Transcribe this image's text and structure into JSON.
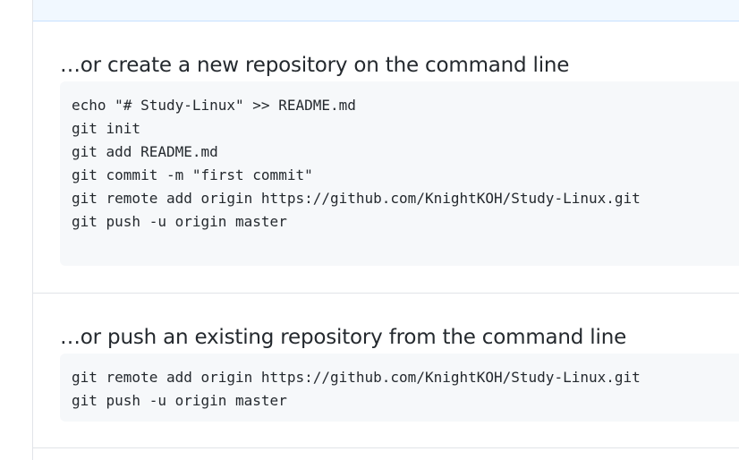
{
  "create_section": {
    "heading": "…or create a new repository on the command line",
    "commands": [
      "echo \"# Study-Linux\" >> README.md",
      "git init",
      "git add README.md",
      "git commit -m \"first commit\"",
      "git remote add origin https://github.com/KnightKOH/Study-Linux.git",
      "git push -u origin master"
    ]
  },
  "push_section": {
    "heading": "…or push an existing repository from the command line",
    "commands": [
      "git remote add origin https://github.com/KnightKOH/Study-Linux.git",
      "git push -u origin master"
    ]
  },
  "colors": {
    "heading_text": "#24292e",
    "code_background": "#f6f8fa",
    "top_band": "#f1f8ff",
    "border": "#e1e4e8"
  }
}
